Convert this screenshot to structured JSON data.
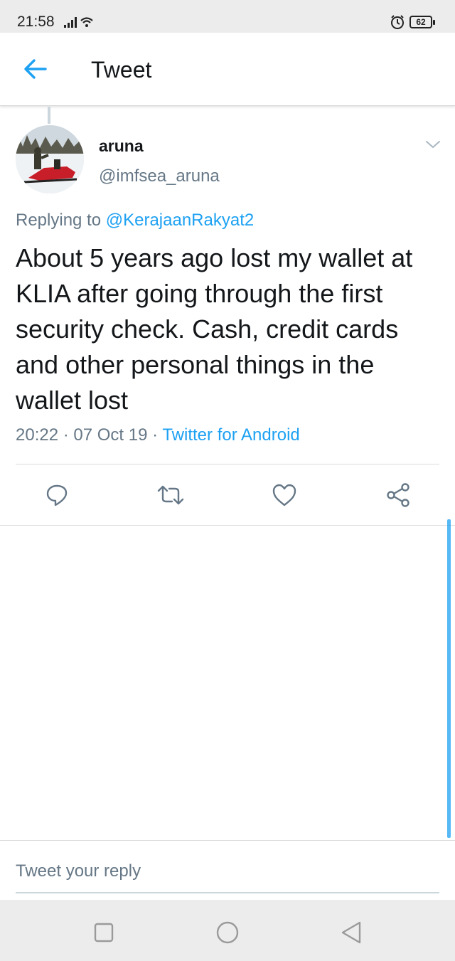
{
  "status_bar": {
    "time": "21:58",
    "battery": "62",
    "icons": [
      "signal-icon",
      "wifi-icon",
      "alarm-icon",
      "battery-icon"
    ]
  },
  "header": {
    "back_icon": "arrow-left-icon",
    "title": "Tweet"
  },
  "tweet": {
    "author_name": "aruna",
    "author_handle": "@imfsea_aruna",
    "replying_prefix": "Replying to",
    "replying_to": "@KerajaanRakyat2",
    "text": "About 5 years ago lost my wallet at KLIA after going through the first security check. Cash, credit cards and other personal things in the wallet lost",
    "timestamp": "20:22 · 07 Oct 19 · ",
    "source": "Twitter for Android",
    "actions": [
      "reply-icon",
      "retweet-icon",
      "like-icon",
      "share-icon"
    ]
  },
  "composer": {
    "placeholder": "Tweet your reply"
  },
  "system_nav": [
    "recents-button",
    "home-button",
    "back-button"
  ],
  "colors": {
    "accent": "#1da1f2",
    "secondary_text": "#657786",
    "primary_text": "#14171a"
  }
}
